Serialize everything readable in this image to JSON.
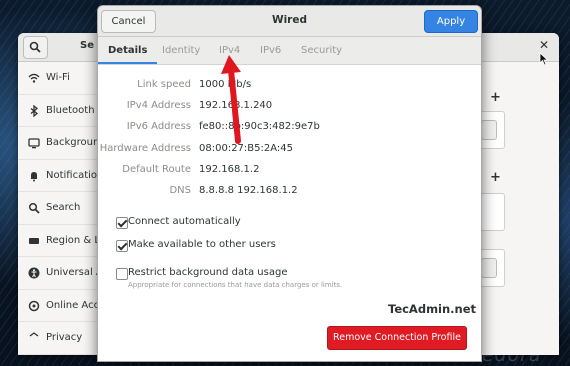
{
  "background": {
    "brand_text": "fedora"
  },
  "settings": {
    "title": "Se",
    "close_icon": "✕",
    "sidebar": {
      "items": [
        {
          "icon": "wifi-icon",
          "label": "Wi-Fi"
        },
        {
          "icon": "bluetooth-icon",
          "label": "Bluetooth"
        },
        {
          "icon": "background-icon",
          "label": "Background"
        },
        {
          "icon": "notification-icon",
          "label": "Notification"
        },
        {
          "icon": "search-icon",
          "label": "Search"
        },
        {
          "icon": "region-icon",
          "label": "Region & La"
        },
        {
          "icon": "universal-access-icon",
          "label": "Universal A"
        },
        {
          "icon": "online-accounts-icon",
          "label": "Online Acco"
        },
        {
          "icon": "privacy-icon",
          "label": "Privacy"
        }
      ]
    },
    "panel": {
      "add_label": "+"
    }
  },
  "dialog": {
    "title": "Wired",
    "cancel_label": "Cancel",
    "apply_label": "Apply",
    "tabs": [
      {
        "label": "Details",
        "active": true
      },
      {
        "label": "Identity",
        "active": false
      },
      {
        "label": "IPv4",
        "active": false
      },
      {
        "label": "IPv6",
        "active": false
      },
      {
        "label": "Security",
        "active": false
      }
    ],
    "details": [
      {
        "key": "Link speed",
        "value": "1000 Mb/s"
      },
      {
        "key": "IPv4 Address",
        "value": "192.168.1.240"
      },
      {
        "key": "IPv6 Address",
        "value": "fe80::8b:90c3:482:9e7b"
      },
      {
        "key": "Hardware Address",
        "value": "08:00:27:B5:2A:45"
      },
      {
        "key": "Default Route",
        "value": "192.168.1.2"
      },
      {
        "key": "DNS",
        "value": "8.8.8.8 192.168.1.2"
      }
    ],
    "options": {
      "connect_automatically": {
        "label": "Connect automatically",
        "checked": true
      },
      "available_to_others": {
        "label": "Make available to other users",
        "checked": true
      },
      "restrict_background": {
        "label": "Restrict background data usage",
        "hint": "Appropriate for connections that have data charges or limits.",
        "checked": false
      }
    },
    "watermark": "TecAdmin.net",
    "remove_label": "Remove Connection Profile"
  },
  "colors": {
    "accent": "#3584e4",
    "destructive": "#e01b24",
    "arrow": "#e0171f"
  }
}
